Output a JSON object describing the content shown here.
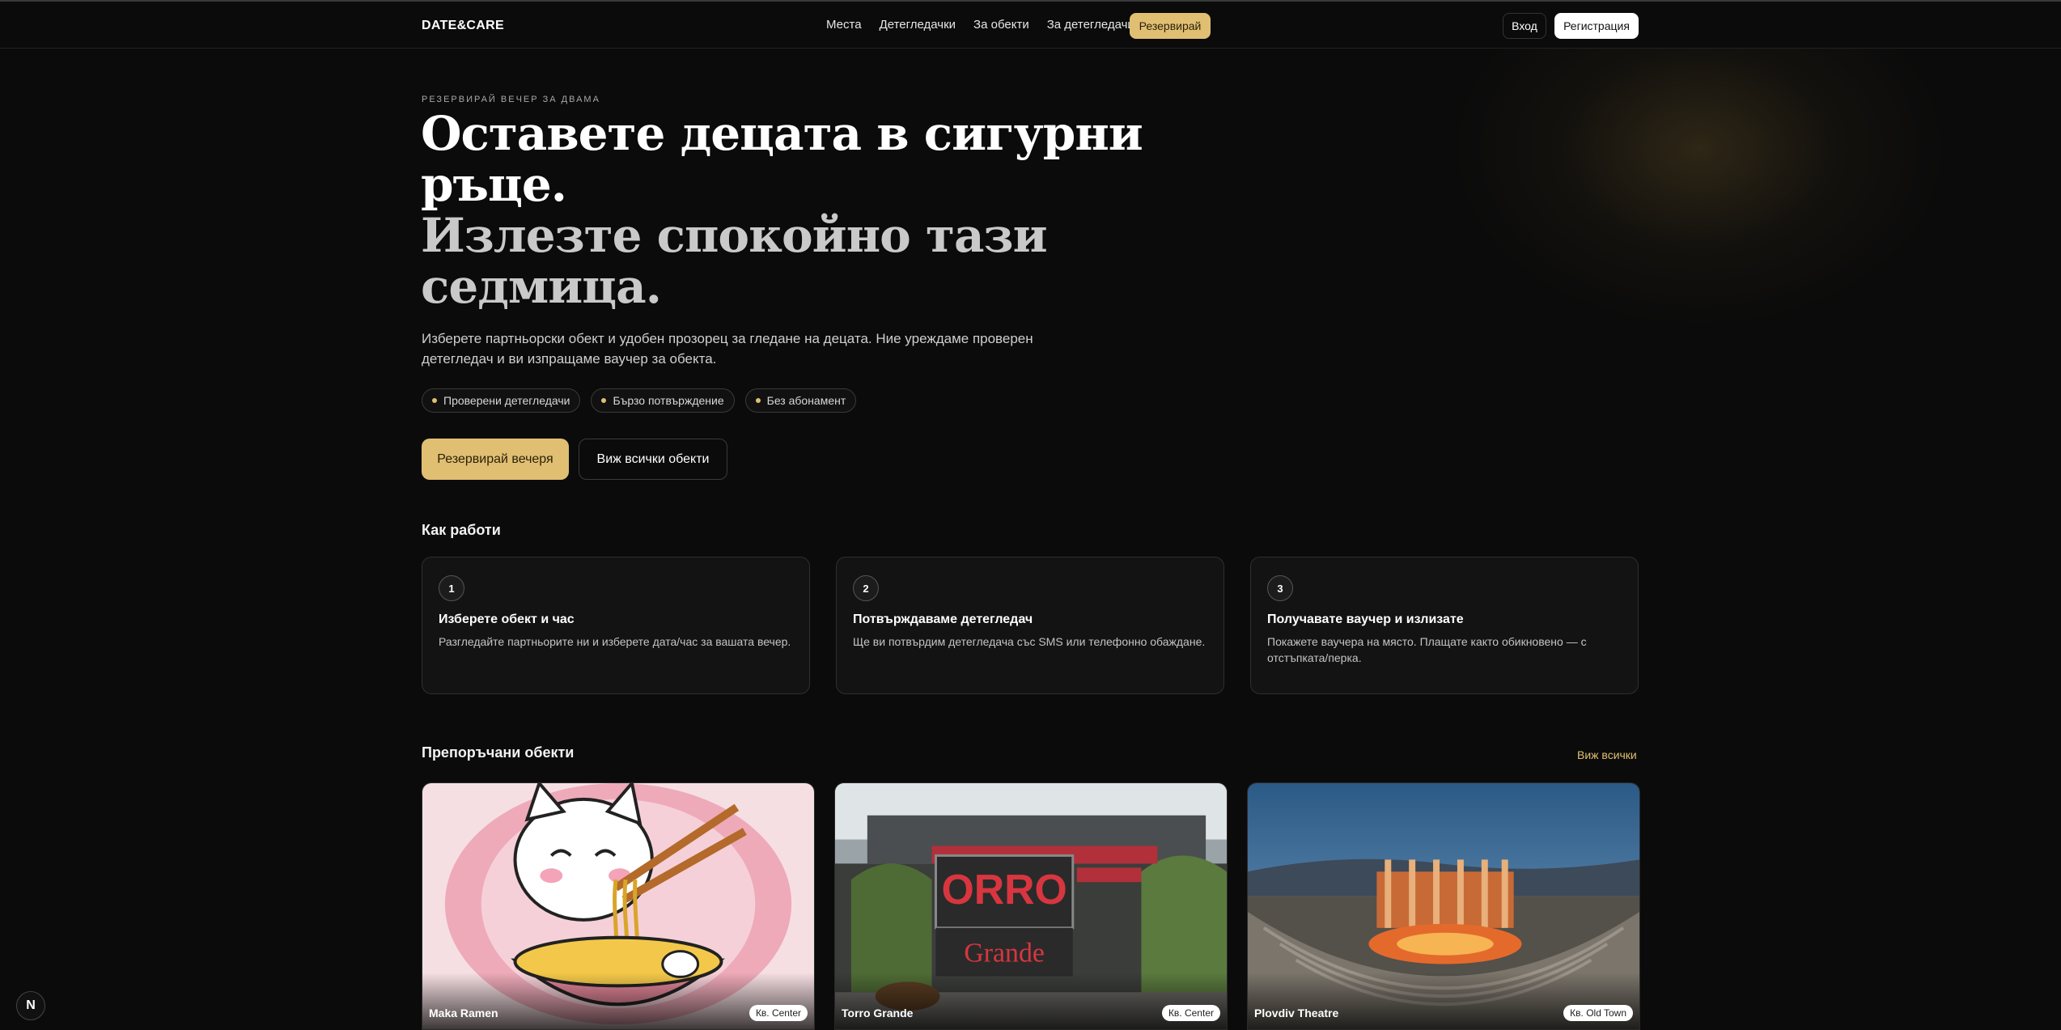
{
  "header": {
    "logo": "DATE&CARE",
    "nav": [
      "Места",
      "Детегледачки",
      "За обекти",
      "За детегледачи"
    ],
    "reserve_label": "Резервирай",
    "login_label": "Вход",
    "register_label": "Регистрация"
  },
  "hero": {
    "eyebrow": "РЕЗЕРВИРАЙ ВЕЧЕР ЗА ДВАМА",
    "title_line1": "Оставете децата в сигурни ръце.",
    "title_line2": "Излезте спокойно тази седмица.",
    "description": "Изберете партньорски обект и удобен прозорец за гледане на децата. Ние уреждаме проверен детегледач и ви изпращаме ваучер за обекта.",
    "pills": [
      "Проверени детегледачи",
      "Бързо потвърждение",
      "Без абонамент"
    ],
    "cta_primary": "Резервирай вечеря",
    "cta_secondary": "Виж всички обекти"
  },
  "how_it_works": {
    "title": "Как работи",
    "steps": [
      {
        "num": "1",
        "title": "Изберете обект и час",
        "desc": "Разгледайте партньорите ни и изберете дата/час за вашата вечер."
      },
      {
        "num": "2",
        "title": "Потвърждаваме детегледач",
        "desc": "Ще ви потвърдим детегледача със SMS или телефонно обаждане."
      },
      {
        "num": "3",
        "title": "Получавате ваучер и излизате",
        "desc": "Покажете ваучера на място. Плащате както обикновено — с отстъпката/перка."
      }
    ]
  },
  "venues": {
    "title": "Препоръчани обекти",
    "view_all": "Виж всички",
    "items": [
      {
        "name": "Maka Ramen",
        "badge": "Кв. Center"
      },
      {
        "name": "Torro Grande",
        "badge": "Кв. Center"
      },
      {
        "name": "Plovdiv Theatre",
        "badge": "Кв. Old Town"
      }
    ]
  },
  "dev_badge": "N",
  "colors": {
    "accent": "#e0bf72",
    "background": "#0b0b0b"
  }
}
